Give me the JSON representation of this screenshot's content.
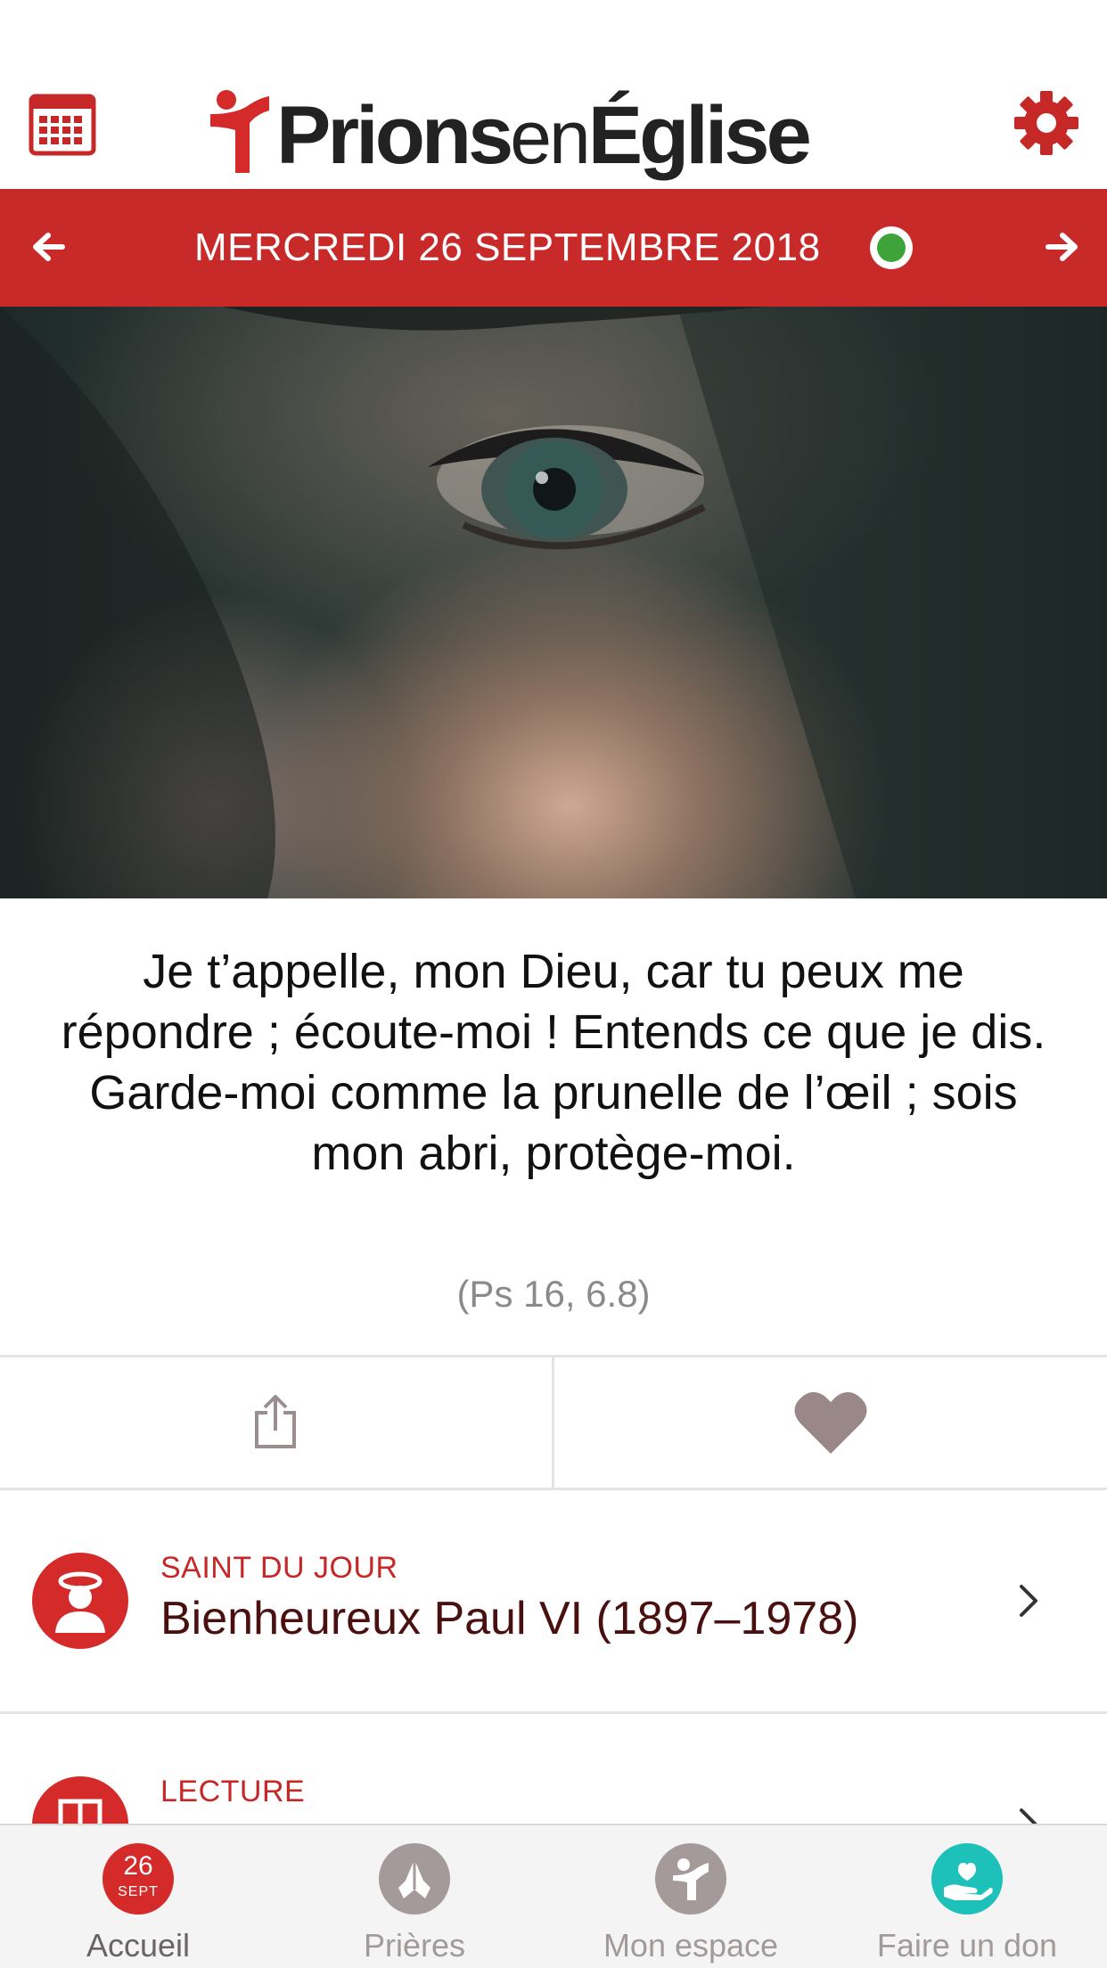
{
  "header": {
    "logo_text_bold_1": "Prions",
    "logo_text_thin": "en",
    "logo_text_bold_2": "Église",
    "accent_color": "#c82a2a",
    "calendar_icon": "calendar-icon",
    "settings_icon": "gear-icon"
  },
  "date_bar": {
    "date": "MERCREDI 26 SEPTEMBRE 2018",
    "prev_icon": "arrow-left-icon",
    "next_icon": "arrow-right-icon",
    "status_color": "#3ea33b"
  },
  "verse": {
    "text": "Je t’appelle, mon Dieu, car tu peux me répondre ; écoute-moi ! Entends ce que je dis. Garde-moi comme la prunelle de l’œil ; sois mon abri, protège-moi.",
    "reference": "(Ps 16, 6.8)"
  },
  "actions": {
    "share_icon": "share-icon",
    "favorite_icon": "heart-icon"
  },
  "list": [
    {
      "kicker": "SAINT DU JOUR",
      "title": "Bienheureux Paul VI (1897–1978)",
      "icon": "saint-icon"
    },
    {
      "kicker": "LECTURE",
      "title": "",
      "icon": "book-icon"
    }
  ],
  "tabs": [
    {
      "label": "Accueil",
      "badge_day": "26",
      "badge_month": "SEPT",
      "active": true,
      "color": "#d42a2a"
    },
    {
      "label": "Prières",
      "icon": "praying-hands-icon",
      "color": "#a59a9a"
    },
    {
      "label": "Mon espace",
      "icon": "person-icon",
      "color": "#a59a9a"
    },
    {
      "label": "Faire un don",
      "icon": "donate-hand-icon",
      "color": "#1ec1b9"
    }
  ]
}
